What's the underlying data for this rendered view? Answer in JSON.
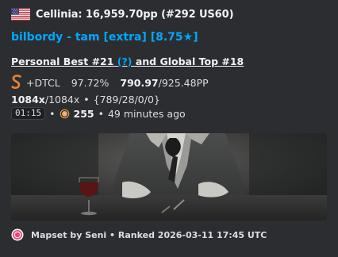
{
  "author": {
    "flag": "us-flag",
    "text": "Cellinia: 16,959.70pp (#292 US60)"
  },
  "title": "bilbordy - tam [extra] [8.75★]",
  "personal_best": {
    "prefix": "Personal Best #21 ",
    "link": "(?)",
    "suffix": " and Global Top #18"
  },
  "stats": {
    "grade_icon": "grade-s-icon",
    "mods": "+DTCL",
    "accuracy": "97.72%",
    "pp_value": "790.97",
    "pp_max": "/925.48PP",
    "combo": "1084x",
    "max_combo": "/1084x",
    "separator": "•",
    "hits": "{789/28/0/0}",
    "length": "01:15",
    "mode_icon": "osu-mode-icon",
    "bpm": "255",
    "time_ago": "49 minutes ago"
  },
  "image": {
    "description_icon": "beatmap-background-image"
  },
  "footer": {
    "icon": "osu-logo-icon",
    "text": "Mapset by Seni • Ranked 2026-03-11 17:45 UTC"
  },
  "colors": {
    "embed_background": "#2b2d31",
    "title_link": "#00a8fc",
    "grade_s": "#f0822e",
    "mode_icon": "#e9a8d8"
  }
}
